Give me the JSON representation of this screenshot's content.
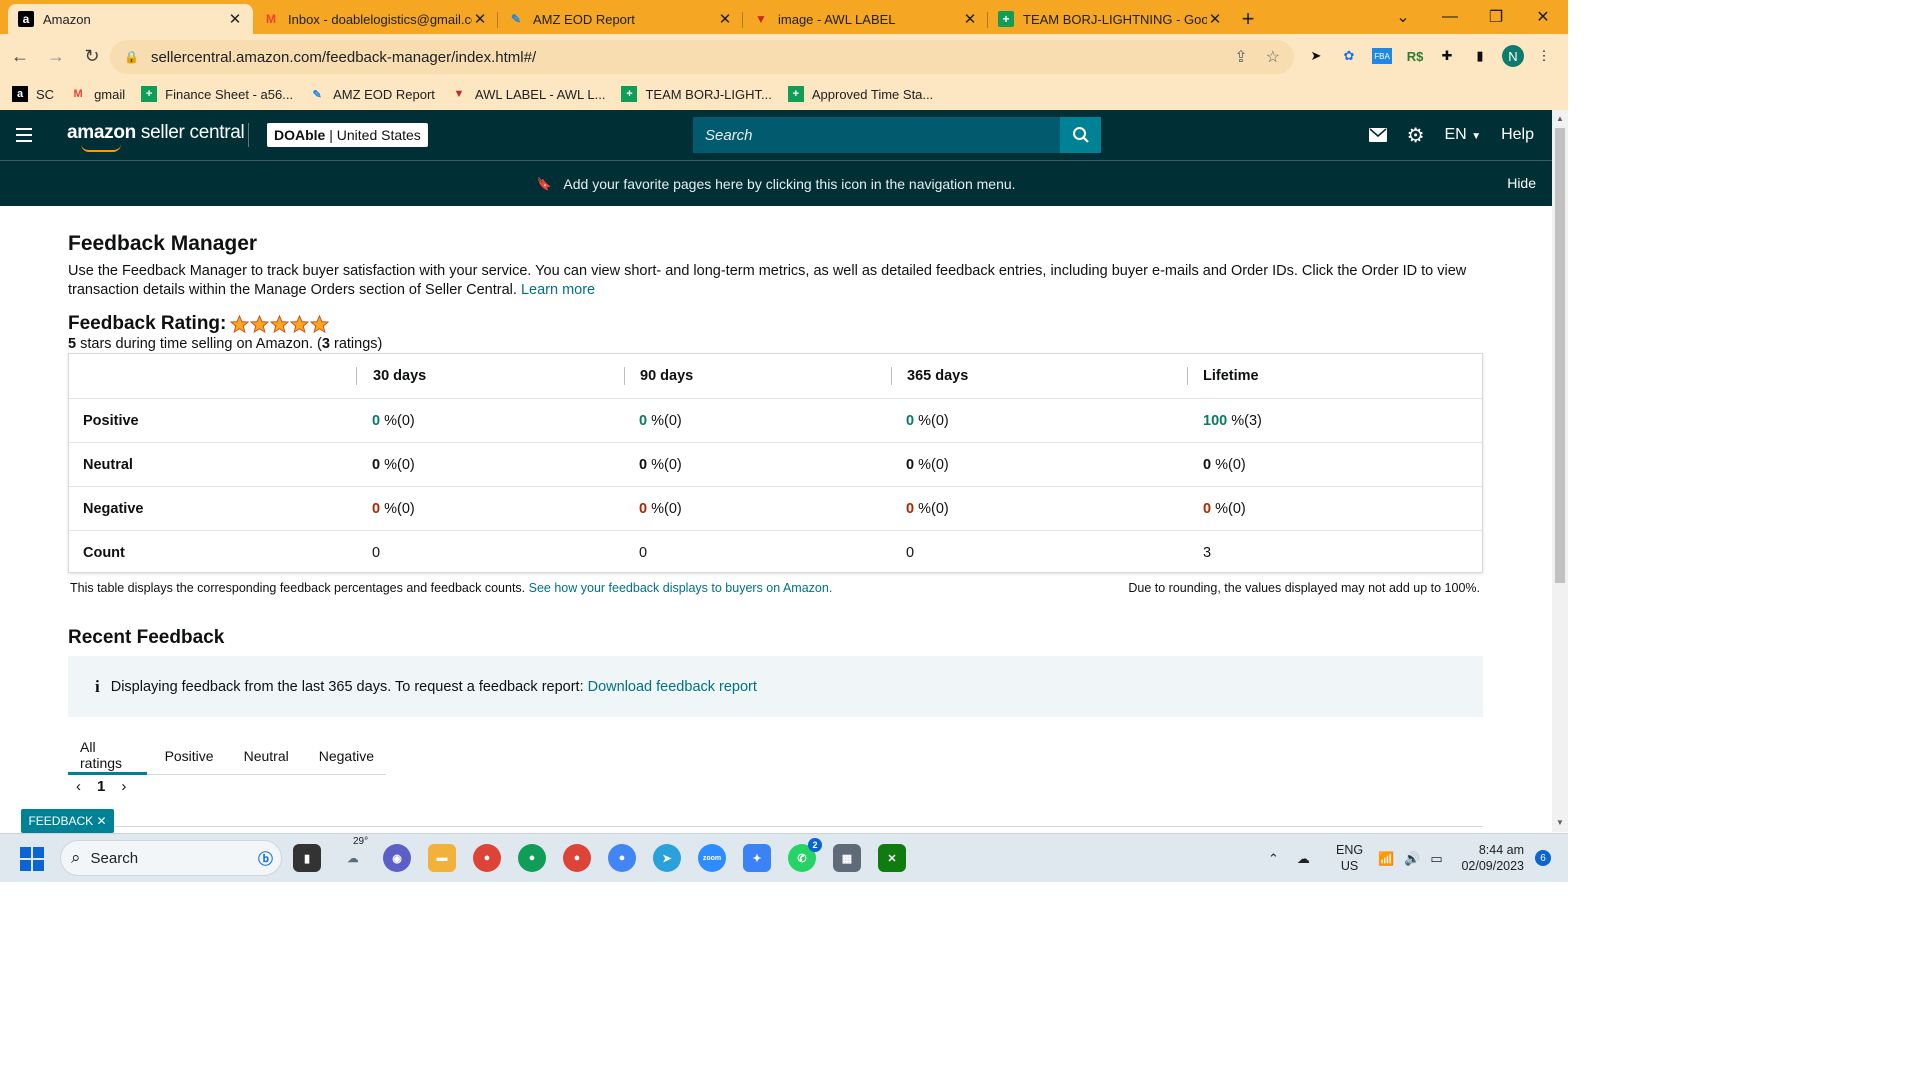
{
  "browser": {
    "tabs": [
      {
        "title": "Amazon",
        "favicon": "amazon-icon"
      },
      {
        "title": "Inbox - doablelogistics@gmail.co",
        "favicon": "gmail-icon"
      },
      {
        "title": "AMZ EOD Report",
        "favicon": "eod-icon"
      },
      {
        "title": "image - AWL LABEL",
        "favicon": "awl-icon"
      },
      {
        "title": "TEAM BORJ-LIGHTNING - Googl",
        "favicon": "sheets-icon"
      }
    ],
    "url": "sellercentral.amazon.com/feedback-manager/index.html#/",
    "profile_initial": "N",
    "bookmarks": [
      {
        "label": "SC",
        "icon": "amazon-icon"
      },
      {
        "label": "gmail",
        "icon": "gmail-icon"
      },
      {
        "label": "Finance Sheet - a56...",
        "icon": "sheets-icon"
      },
      {
        "label": "AMZ EOD Report",
        "icon": "eod-icon"
      },
      {
        "label": "AWL LABEL - AWL L...",
        "icon": "awl-icon"
      },
      {
        "label": "TEAM BORJ-LIGHT...",
        "icon": "sheets-icon"
      },
      {
        "label": "Approved Time Sta...",
        "icon": "sheets-icon"
      }
    ]
  },
  "header": {
    "logo_amazon": "amazon",
    "logo_rest": " seller central",
    "account_store": "DOAble",
    "account_region": " | United States",
    "search_placeholder": "Search",
    "lang": "EN",
    "help": "Help",
    "favorites_hint": "Add your favorite pages here by clicking this icon in the navigation menu.",
    "hide": "Hide"
  },
  "page": {
    "title": "Feedback Manager",
    "description": "Use the Feedback Manager to track buyer satisfaction with your service. You can view short- and long-term metrics, as well as detailed feedback entries, including buyer e-mails and Order IDs. Click the Order ID to view transaction details within the Manage Orders section of Seller Central.",
    "learn_more": "Learn more",
    "rating_title": "Feedback Rating:",
    "stars": 5,
    "rating_stars_value": "5",
    "rating_text_a": " stars during time selling on Amazon. (",
    "rating_count": "3",
    "rating_text_b": " ratings)"
  },
  "feedback_table": {
    "columns": [
      "30 days",
      "90 days",
      "365 days",
      "Lifetime"
    ],
    "rows": [
      {
        "label": "Positive",
        "cells": [
          {
            "v": "0",
            "s": " %(0)"
          },
          {
            "v": "0",
            "s": " %(0)"
          },
          {
            "v": "0",
            "s": " %(0)"
          },
          {
            "v": "100",
            "s": " %(3)"
          }
        ]
      },
      {
        "label": "Neutral",
        "cells": [
          {
            "v": "0",
            "s": " %(0)"
          },
          {
            "v": "0",
            "s": " %(0)"
          },
          {
            "v": "0",
            "s": " %(0)"
          },
          {
            "v": "0",
            "s": " %(0)"
          }
        ]
      },
      {
        "label": "Negative",
        "cells": [
          {
            "v": "0",
            "s": " %(0)"
          },
          {
            "v": "0",
            "s": " %(0)"
          },
          {
            "v": "0",
            "s": " %(0)"
          },
          {
            "v": "0",
            "s": " %(0)"
          }
        ]
      },
      {
        "label": "Count",
        "cells": [
          {
            "v": "0",
            "s": ""
          },
          {
            "v": "0",
            "s": ""
          },
          {
            "v": "0",
            "s": ""
          },
          {
            "v": "3",
            "s": ""
          }
        ]
      }
    ],
    "footnote": "This table displays the corresponding feedback percentages and feedback counts.",
    "footnote_link": "See how your feedback displays to buyers on Amazon.",
    "rounding_note": "Due to rounding, the values displayed may not add up to 100%."
  },
  "recent": {
    "title": "Recent Feedback",
    "info": "Displaying feedback from the last 365 days. To request a feedback report:",
    "info_link": "Download feedback report",
    "tabs": [
      "All ratings",
      "Positive",
      "Neutral",
      "Negative"
    ],
    "page": "1"
  },
  "feedback_tag": "FEEDBACK",
  "taskbar": {
    "search": "Search",
    "weather": "29°",
    "lang_1": "ENG",
    "lang_2": "US",
    "time": "8:44 am",
    "date": "02/09/2023",
    "notifications": "6",
    "whatsapp_badge": "2"
  },
  "colors": {
    "tabstrip": "#f5a623",
    "header": "#002f36",
    "accent": "#008296",
    "positive": "#067d62",
    "negative": "#b12704",
    "link": "#007185"
  }
}
